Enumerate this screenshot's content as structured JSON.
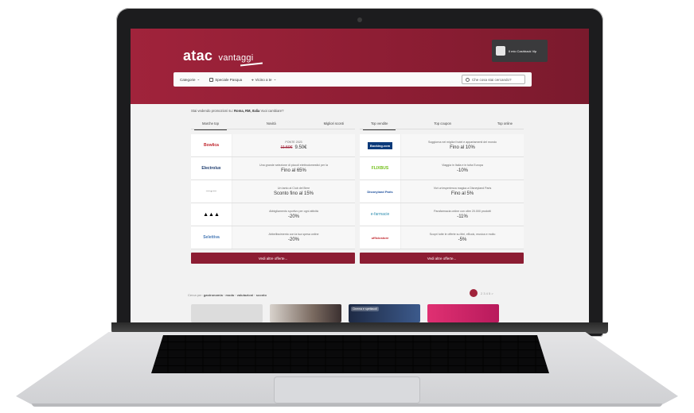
{
  "header": {
    "logo_main": "atac",
    "logo_sub": "vantaggi",
    "cashback_label": "Il mio Cashback Vip"
  },
  "nav": {
    "categories": "Categorie",
    "special": "Speciale Pasqua",
    "location": "Vicino a te",
    "search_placeholder": "Che cosa stai cercando?"
  },
  "intro": {
    "text": "Stai vedendo promozioni su: ",
    "location": "Roma, RM, Italia",
    "change": "Vuoi cambiare?"
  },
  "left": {
    "tabs": [
      "Marche top",
      "Novità",
      "Migliori sconti"
    ],
    "active_tab": 0,
    "rows": [
      {
        "brand": "Bowlica",
        "desc": "PONTE 2023",
        "old_price": "11.50€",
        "price": "9.50€"
      },
      {
        "brand": "Electrolux",
        "desc": "Una grande selezione di piccoli elettrodomestici per la",
        "old_price": "",
        "price": "Fino al 65%"
      },
      {
        "brand": "—∘—",
        "desc": "Un tanto al Club del Bere",
        "old_price": "",
        "price": "Sconto fino al 15%"
      },
      {
        "brand": "adidas",
        "desc": "Abbigliamento sportivo per ogni attività",
        "old_price": "",
        "price": "-20%"
      },
      {
        "brand": "Selettiva",
        "desc": "Abbellissimento con la tua spesa online",
        "old_price": "",
        "price": "-20%"
      }
    ],
    "more": "Vedi altre offerte..."
  },
  "right": {
    "tabs": [
      "Top vendite",
      "Top coupon",
      "Top online"
    ],
    "active_tab": 0,
    "rows": [
      {
        "brand": "Booking.com",
        "desc": "Soggiorna nei migliori hotel e appartamenti del mondo",
        "price": "Fino al 10%"
      },
      {
        "brand": "FLIXBUS",
        "desc": "Viaggia in Italia e in tutta Europa",
        "price": "-10%"
      },
      {
        "brand": "Disneyland Paris",
        "desc": "Vivi un'esperienza magica a Disneyland Paris",
        "price": "Fino al 5%"
      },
      {
        "brand": "e-farmacie",
        "desc": "Parafarmacia online con oltre 20.000 prodotti",
        "price": "-11%"
      },
      {
        "brand": "ufficiostore",
        "desc": "Scopri tutte le offerte su libri, eBook, musica e molto",
        "price": "-5%"
      }
    ],
    "more": "Vedi altre offerte..."
  },
  "categories_line": {
    "prefix": "Cerca per: ",
    "items": "gastronomia · moda · valutazioni · sconto"
  },
  "pager": {
    "pages": "2  3  4  5  >"
  },
  "thumbs": {
    "badge": "Cinema e spettacoli"
  },
  "colors": {
    "brand": "#8c1d33",
    "accent": "#a0233b"
  }
}
